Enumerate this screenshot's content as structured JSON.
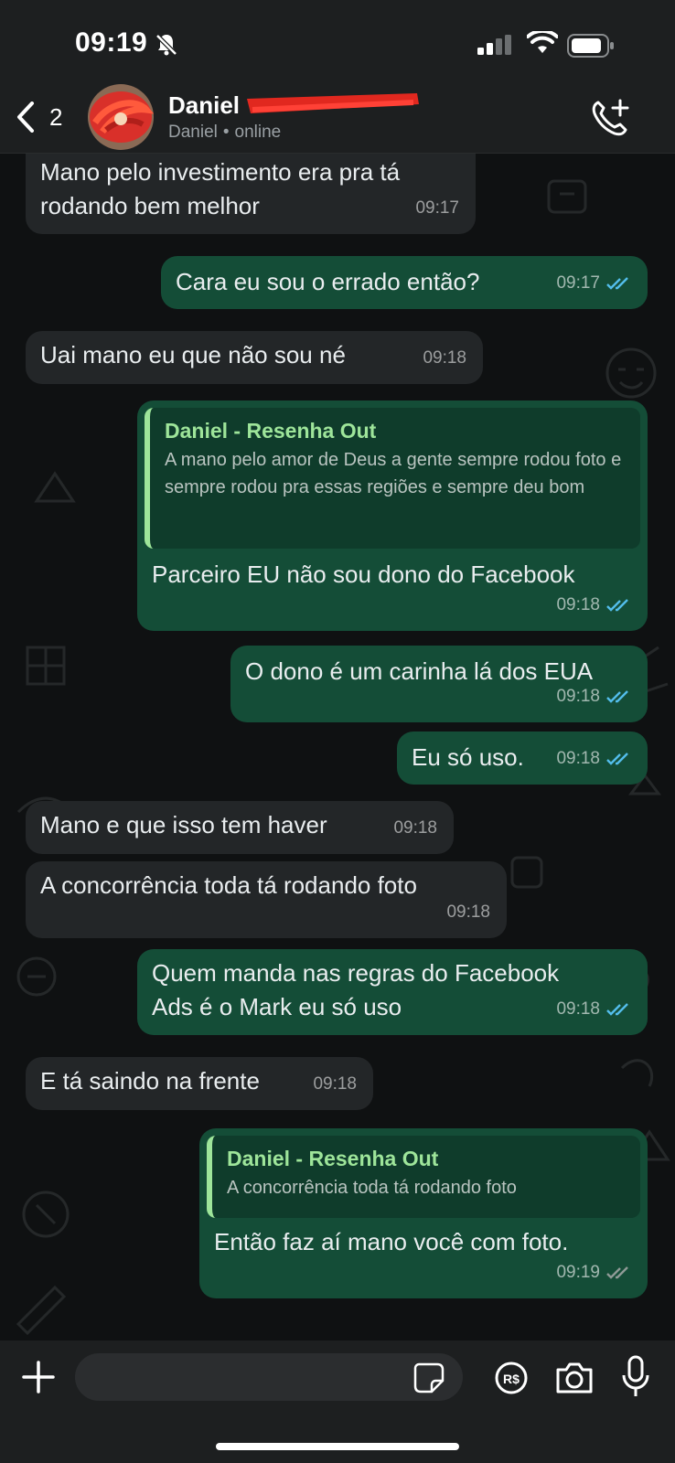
{
  "status_bar": {
    "time": "09:19"
  },
  "header": {
    "back_count": "2",
    "contact_name": "Daniel",
    "contact_sub_name": "Daniel",
    "contact_status": "online"
  },
  "messages": [
    {
      "dir": "in",
      "text": "Mano pelo investimento era pra tá\nrodando bem melhor",
      "time": "09:17"
    },
    {
      "dir": "out",
      "text": "Cara eu sou o errado então?",
      "time": "09:17",
      "read": true
    },
    {
      "dir": "in",
      "text": "Uai mano eu que não sou né",
      "time": "09:18"
    },
    {
      "dir": "out",
      "quote_author": "Daniel - Resenha Out",
      "quote_text": "A mano pelo amor de Deus a gente sempre rodou foto e sempre rodou pra essas regiões e sempre deu bom",
      "text": "Parceiro EU não sou dono do Facebook",
      "time": "09:18",
      "read": true
    },
    {
      "dir": "out",
      "text": "O dono é um carinha lá dos EUA",
      "time": "09:18",
      "read": true
    },
    {
      "dir": "out",
      "text": "Eu só uso.",
      "time": "09:18",
      "read": true
    },
    {
      "dir": "in",
      "text": "Mano e que isso tem haver",
      "time": "09:18"
    },
    {
      "dir": "in",
      "text": "A concorrência toda tá rodando foto",
      "time": "09:18"
    },
    {
      "dir": "out",
      "text": "Quem manda nas regras do Facebook\nAds é o Mark eu só uso",
      "time": "09:18",
      "read": true
    },
    {
      "dir": "in",
      "text": "E tá saindo na frente",
      "time": "09:18"
    },
    {
      "dir": "out",
      "quote_author": "Daniel - Resenha Out",
      "quote_text": "A concorrência toda tá rodando foto",
      "text": "Então faz aí mano você com foto.",
      "time": "09:19",
      "read": false
    }
  ],
  "colors": {
    "incoming_bubble": "#232628",
    "outgoing_bubble": "#144d37",
    "read_ticks": "#53bdeb",
    "sent_ticks": "#8f9a96",
    "quote_accent": "#9ee59a"
  },
  "icons": [
    "back-chevron-icon",
    "bell-muted-icon",
    "signal-icon",
    "wifi-icon",
    "battery-icon",
    "call-add-icon",
    "plus-icon",
    "sticker-icon",
    "pix-icon",
    "camera-icon",
    "mic-icon"
  ]
}
